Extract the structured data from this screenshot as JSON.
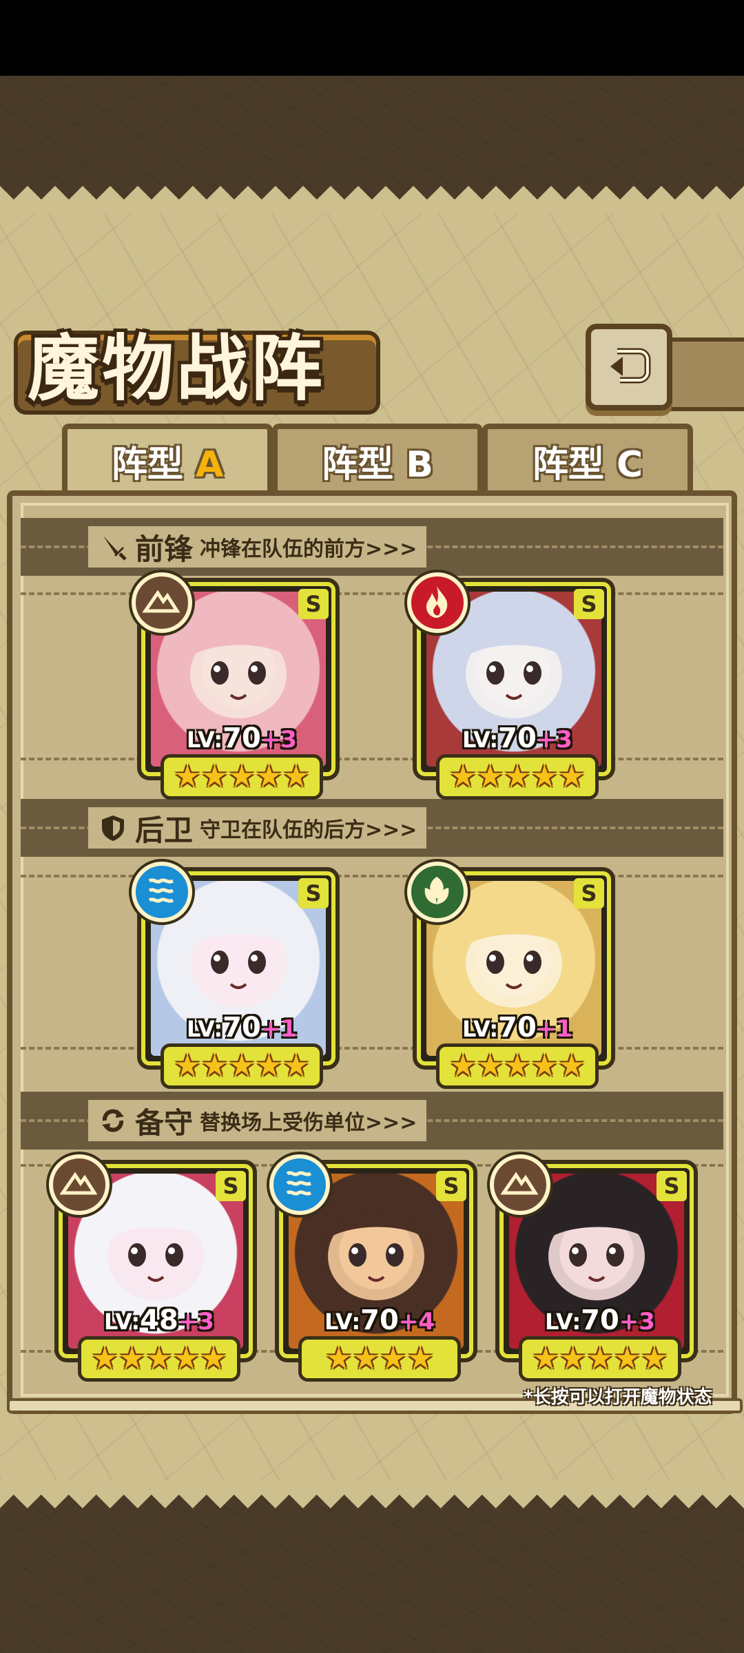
{
  "title": "魔物战阵",
  "tabs": [
    {
      "prefix": "阵型",
      "letter": "A",
      "active": true
    },
    {
      "prefix": "阵型",
      "letter": "B",
      "active": false
    },
    {
      "prefix": "阵型",
      "letter": "C",
      "active": false
    }
  ],
  "sections": {
    "front": {
      "title": "前锋",
      "desc": "冲锋在队伍的前方>>>",
      "icon": "sword-icon"
    },
    "rear": {
      "title": "后卫",
      "desc": "守卫在队伍的后方>>>",
      "icon": "shield-icon"
    },
    "reserve": {
      "title": "备守",
      "desc": "替换场上受伤单位>>>",
      "icon": "swap-icon"
    }
  },
  "lv_tag": "LV:",
  "cards": [
    {
      "level": "70",
      "plus": "+3",
      "rank": "S",
      "stars": 5,
      "element": "earth",
      "element_color": "#6b4a33",
      "portrait_colors": [
        "#f0b8c0",
        "#f6e3dc",
        "#d9607a"
      ]
    },
    {
      "level": "70",
      "plus": "+3",
      "rank": "S",
      "stars": 5,
      "element": "fire",
      "element_color": "#c81a28",
      "portrait_colors": [
        "#cfd6ea",
        "#f4f1f0",
        "#a83a3a"
      ]
    },
    {
      "level": "70",
      "plus": "+1",
      "rank": "S",
      "stars": 5,
      "element": "water",
      "element_color": "#1a8fd4",
      "portrait_colors": [
        "#eef0f6",
        "#f9e9ef",
        "#b5c8e6"
      ]
    },
    {
      "level": "70",
      "plus": "+1",
      "rank": "S",
      "stars": 5,
      "element": "wind",
      "element_color": "#2f6b33",
      "portrait_colors": [
        "#f4d98a",
        "#fbefd6",
        "#d9b25a"
      ]
    },
    {
      "level": "48",
      "plus": "+3",
      "rank": "S",
      "stars": 5,
      "element": "earth",
      "element_color": "#6b4a33",
      "portrait_colors": [
        "#f4f4f8",
        "#f8e8ee",
        "#c94060"
      ]
    },
    {
      "level": "70",
      "plus": "+4",
      "rank": "S",
      "stars": 4,
      "element": "water",
      "element_color": "#1a8fd4",
      "portrait_colors": [
        "#4a2f25",
        "#f2c79a",
        "#c46a20"
      ]
    },
    {
      "level": "70",
      "plus": "+3",
      "rank": "S",
      "stars": 5,
      "element": "earth",
      "element_color": "#6b4a33",
      "portrait_colors": [
        "#2a2326",
        "#f3dada",
        "#b02030"
      ]
    }
  ],
  "footnote": "*长按可以打开魔物状态",
  "colors": {
    "card_border": "#e3e23a",
    "plus": "#ff5ec8",
    "active_tab_letter": "#f6b30d"
  }
}
